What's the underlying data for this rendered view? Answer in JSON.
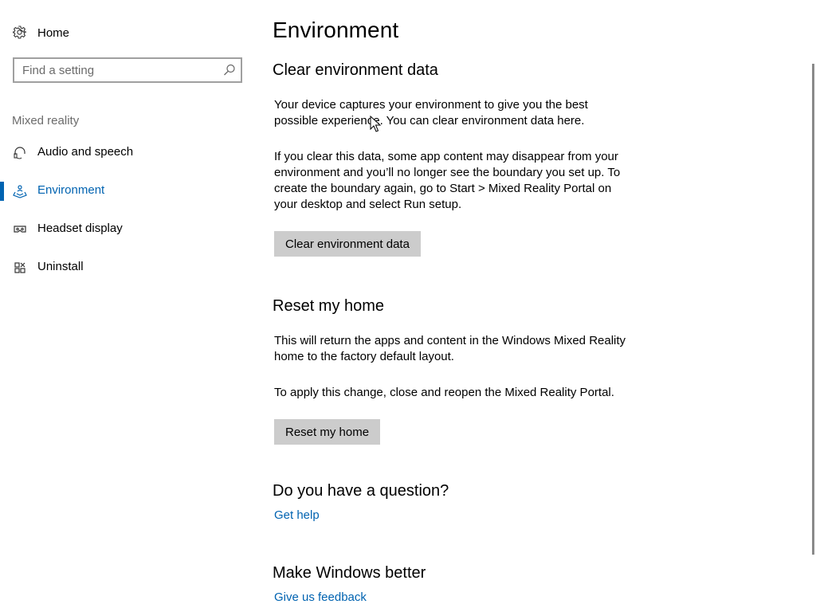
{
  "sidebar": {
    "home_label": "Home",
    "search": {
      "placeholder": "Find a setting",
      "value": ""
    },
    "section_label": "Mixed reality",
    "items": [
      {
        "label": "Audio and speech",
        "icon": "headset-icon",
        "active": false
      },
      {
        "label": "Environment",
        "icon": "environment-icon",
        "active": true
      },
      {
        "label": "Headset display",
        "icon": "headset-display-icon",
        "active": false
      },
      {
        "label": "Uninstall",
        "icon": "uninstall-icon",
        "active": false
      }
    ]
  },
  "main": {
    "title": "Environment",
    "clear": {
      "heading": "Clear environment data",
      "para1": "Your device captures your environment to give you the best possible experience. You can clear environment data here.",
      "para2": "If you clear this data, some app content may disappear from your environment and you’ll no longer see the boundary you set up. To create the boundary again, go to Start > Mixed Reality Portal on your desktop and select Run setup.",
      "button": "Clear environment data"
    },
    "reset": {
      "heading": "Reset my home",
      "para1": "This will return the apps and content in the Windows Mixed Reality home to the factory default layout.",
      "para2": "To apply this change, close and reopen the Mixed Reality Portal.",
      "button": "Reset my home"
    },
    "question": {
      "heading": "Do you have a question?",
      "link": "Get help"
    },
    "feedback": {
      "heading": "Make Windows better",
      "link": "Give us feedback"
    }
  },
  "colors": {
    "accent": "#0063b1",
    "button_bg": "#cccccc",
    "muted_text": "#6b6b6b"
  }
}
